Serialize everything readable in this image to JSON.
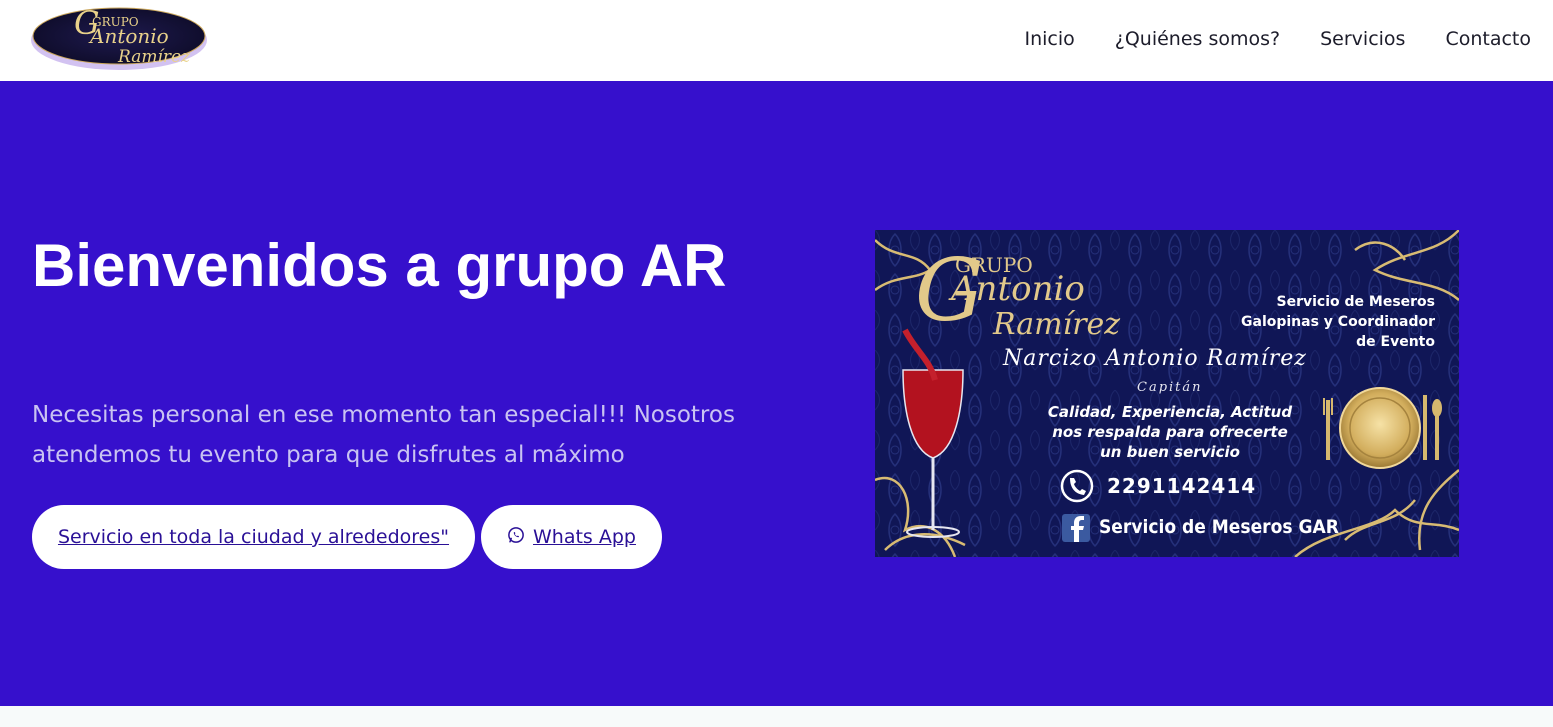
{
  "header": {
    "logo": {
      "line1": "GRUPO",
      "line2": "Antonio",
      "line3": "Ramírez"
    },
    "nav": [
      {
        "label": "Inicio"
      },
      {
        "label": "¿Quiénes somos?"
      },
      {
        "label": "Servicios"
      },
      {
        "label": "Contacto"
      }
    ]
  },
  "hero": {
    "title": "Bienvenidos a grupo AR",
    "subtitle": "Necesitas personal en ese momento tan especial!!! Nosotros atendemos tu evento para que disfrutes al máximo",
    "buttons": {
      "service": "Servicio en toda la ciudad y alrededores\"",
      "whatsapp": "Whats App"
    },
    "colors": {
      "background": "#3610cc",
      "button_text": "#2a1096"
    }
  },
  "card": {
    "logo_line1": "GRUPO",
    "logo_line2": "Antonio",
    "logo_line3": "Ramírez",
    "services_line1": "Servicio de Meseros",
    "services_line2": "Galopinas y Coordinador",
    "services_line3": "de Evento",
    "name": "Narcizo Antonio Ramírez",
    "role": "Capitán",
    "quality_line1": "Calidad, Experiencia, Actitud",
    "quality_line2": "nos respalda para ofrecerte",
    "quality_line3": "un buen servicio",
    "phone": "2291142414",
    "facebook": "Servicio de Meseros GAR"
  }
}
